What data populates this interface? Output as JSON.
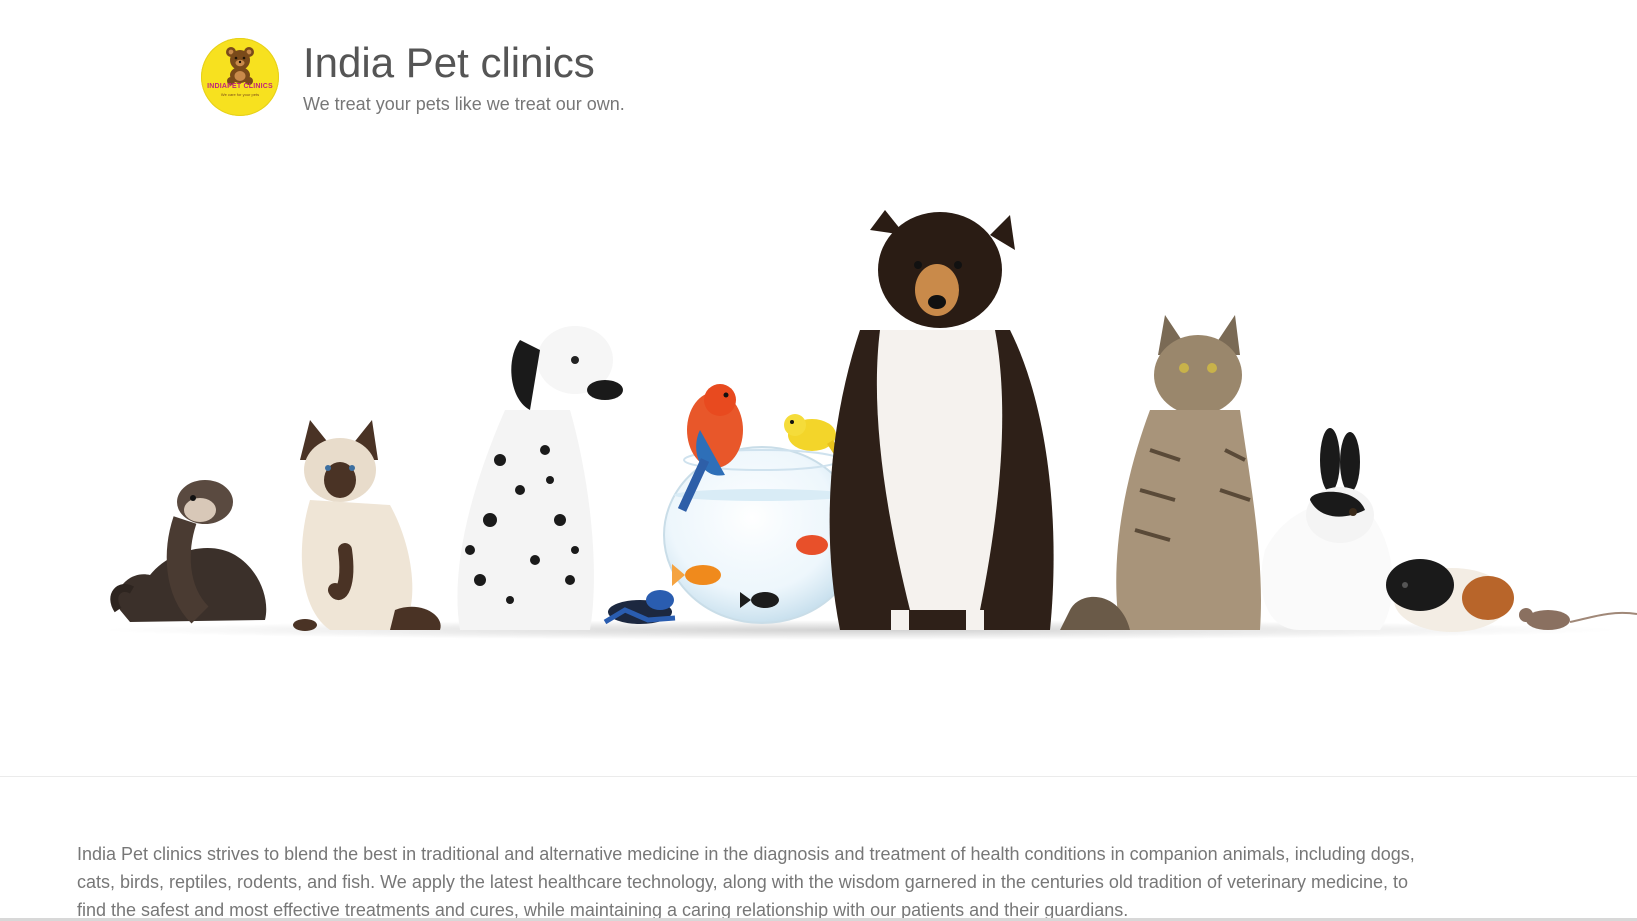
{
  "header": {
    "logo": {
      "text": "INDIAPET CLINICS",
      "subtext": "We care for your pets",
      "icon": "teddy-bear-icon",
      "background": "#f7e11f",
      "text_color": "#c0257a"
    },
    "title": "India Pet clinics",
    "tagline": "We treat your pets like we treat our own."
  },
  "hero": {
    "image": "pets-lineup-banner",
    "animals": [
      "ferret",
      "siamese-cat",
      "dalmatian",
      "frog",
      "parrot",
      "canary",
      "fishbowl",
      "goldfish",
      "collie",
      "tabby-cat",
      "rabbit",
      "guinea-pig",
      "mouse"
    ]
  },
  "intro": {
    "text": "India Pet clinics strives to blend the best in traditional and alternative medicine in the diagnosis and treatment of health conditions in companion animals, including dogs, cats, birds, reptiles, rodents, and fish. We apply the latest healthcare technology, along with the wisdom garnered in the centuries old tradition of veterinary medicine, to find the safest and most effective treatments and cures, while maintaining a caring relationship with our patients and their guardians."
  },
  "colors": {
    "title": "#555555",
    "body_text": "#777777",
    "background": "#ffffff"
  }
}
